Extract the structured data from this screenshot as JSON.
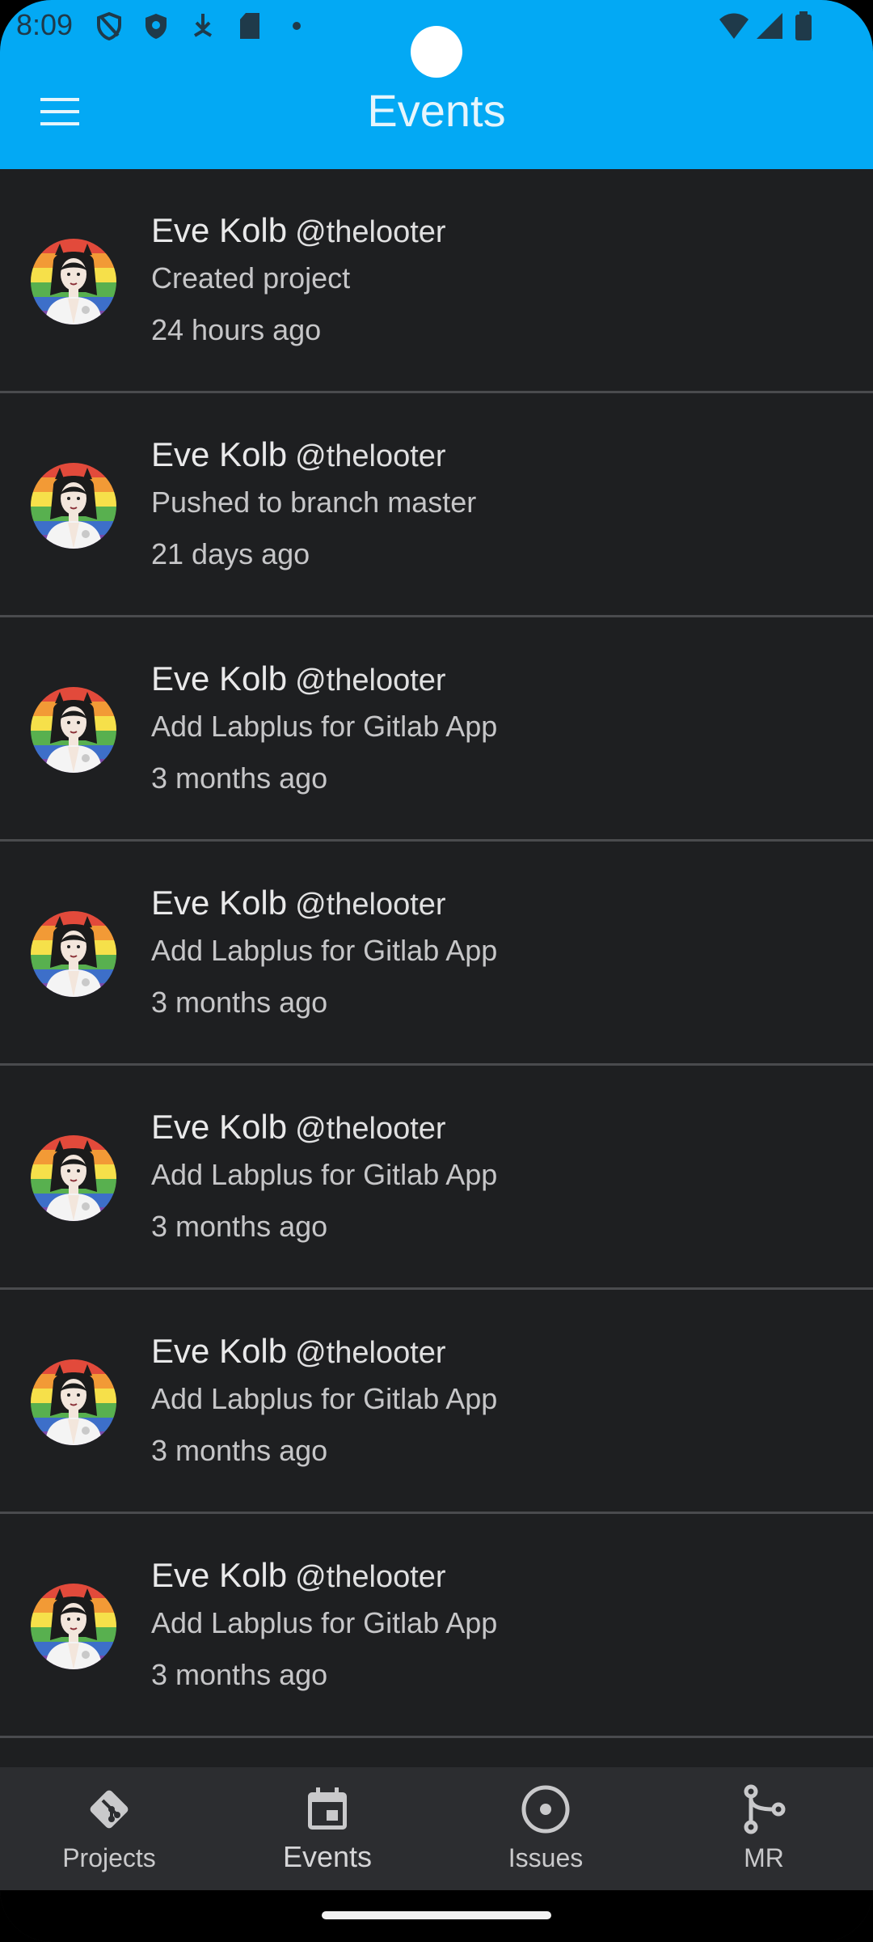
{
  "status_bar": {
    "time": "8:09"
  },
  "app_bar": {
    "title": "Events",
    "menu_icon": "hamburger-menu-icon"
  },
  "events": [
    {
      "name": "Eve Kolb",
      "handle": "@thelooter",
      "action": "Created project",
      "time": "24 hours ago"
    },
    {
      "name": "Eve Kolb",
      "handle": "@thelooter",
      "action": "Pushed to branch master",
      "time": "21 days ago"
    },
    {
      "name": "Eve Kolb",
      "handle": "@thelooter",
      "action": "Add Labplus for Gitlab App",
      "time": "3 months ago"
    },
    {
      "name": "Eve Kolb",
      "handle": "@thelooter",
      "action": "Add Labplus for Gitlab App",
      "time": "3 months ago"
    },
    {
      "name": "Eve Kolb",
      "handle": "@thelooter",
      "action": "Add Labplus for Gitlab App",
      "time": "3 months ago"
    },
    {
      "name": "Eve Kolb",
      "handle": "@thelooter",
      "action": "Add Labplus for Gitlab App",
      "time": "3 months ago"
    },
    {
      "name": "Eve Kolb",
      "handle": "@thelooter",
      "action": "Add Labplus for Gitlab App",
      "time": "3 months ago"
    }
  ],
  "bottom_nav": {
    "tabs": [
      {
        "label": "Projects",
        "icon": "git-icon",
        "active": false
      },
      {
        "label": "Events",
        "icon": "calendar-icon",
        "active": true
      },
      {
        "label": "Issues",
        "icon": "issue-circle-icon",
        "active": false
      },
      {
        "label": "MR",
        "icon": "merge-request-icon",
        "active": false
      }
    ]
  },
  "colors": {
    "app_bar": "#03a9f4",
    "background": "#1e1f21",
    "bottom_nav": "#2c2d30",
    "divider": "#4a4b4e"
  }
}
